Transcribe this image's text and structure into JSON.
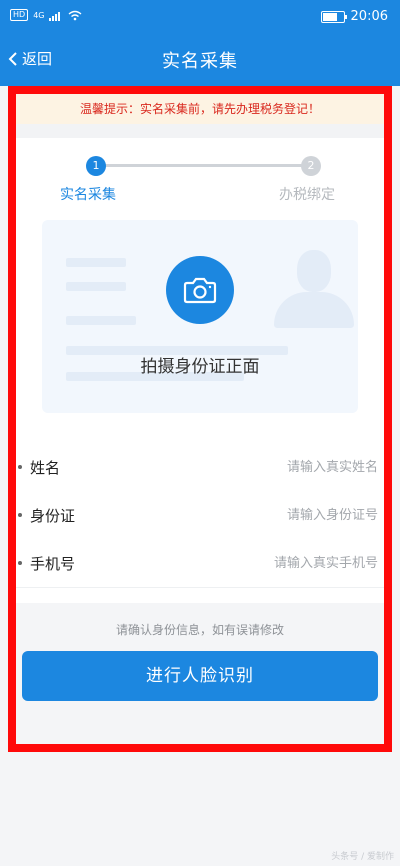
{
  "status_bar": {
    "network_badge": "HD",
    "signal_label": "4G",
    "time": "20:06",
    "battery_level": 0.8
  },
  "nav": {
    "back_label": "返回",
    "title": "实名采集"
  },
  "tip": "温馨提示：实名采集前，请先办理税务登记！",
  "steps": [
    {
      "number": "1",
      "label": "实名采集",
      "active": true
    },
    {
      "number": "2",
      "label": "办税绑定",
      "active": false
    }
  ],
  "id_card": {
    "caption": "拍摄身份证正面",
    "icon": "camera-icon"
  },
  "form": {
    "fields": [
      {
        "label": "姓名",
        "placeholder": "请输入真实姓名",
        "value": ""
      },
      {
        "label": "身份证",
        "placeholder": "请输入身份证号",
        "value": ""
      },
      {
        "label": "手机号",
        "placeholder": "请输入真实手机号",
        "value": ""
      }
    ]
  },
  "confirm_note": "请确认身份信息，如有误请修改",
  "face_button_label": "进行人脸识别",
  "watermark": "头条号 / 爱制作",
  "colors": {
    "primary": "#1c87e0",
    "highlight_border": "#ff0a0a",
    "tip_text": "#d9281e",
    "tip_background": "#fdf3e3"
  }
}
